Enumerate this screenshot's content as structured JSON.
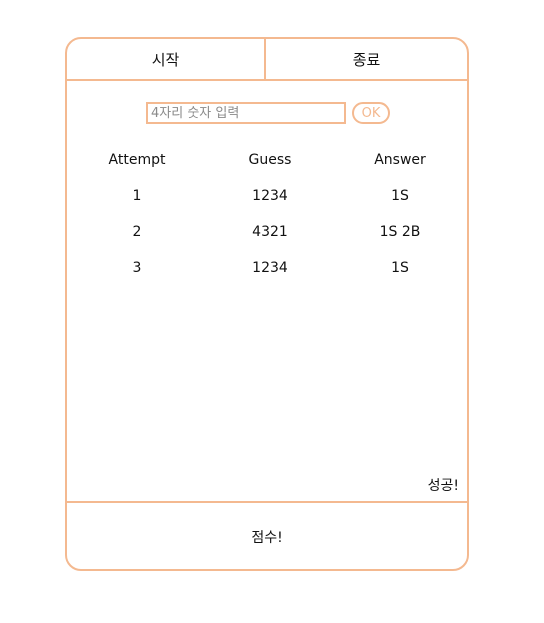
{
  "header": {
    "start_label": "시작",
    "end_label": "종료"
  },
  "input": {
    "placeholder": "4자리 숫자 입력",
    "value": "",
    "ok_label": "OK"
  },
  "table": {
    "columns": [
      "Attempt",
      "Guess",
      "Answer"
    ],
    "rows": [
      [
        "1",
        "1234",
        "1S"
      ],
      [
        "2",
        "4321",
        "1S 2B"
      ],
      [
        "3",
        "1234",
        "1S"
      ]
    ]
  },
  "result": "성공!",
  "footer": {
    "score_label": "점수!"
  },
  "colors": {
    "accent": "#f4b990"
  }
}
